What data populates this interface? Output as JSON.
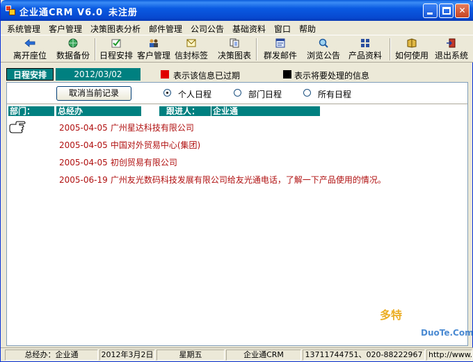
{
  "window": {
    "title": "企业通CRM V6.0",
    "registration": "未注册"
  },
  "menu": [
    "系统管理",
    "客户管理",
    "决策图表分析",
    "邮件管理",
    "公司公告",
    "基础资料",
    "窗口",
    "帮助"
  ],
  "toolbar": [
    {
      "label": "离开座位",
      "icon": "back-arrow-icon"
    },
    {
      "label": "数据备份",
      "icon": "globe-backup-icon"
    },
    {
      "label": "日程安排",
      "icon": "checkmark-schedule-icon"
    },
    {
      "label": "客户管理",
      "icon": "people-icon"
    },
    {
      "label": "信封标签",
      "icon": "envelope-label-icon"
    },
    {
      "label": "决策图表",
      "icon": "documents-icon"
    },
    {
      "label": "群发邮件",
      "icon": "mail-window-icon"
    },
    {
      "label": "浏览公告",
      "icon": "magnifier-icon"
    },
    {
      "label": "产品资料",
      "icon": "grid-icon"
    },
    {
      "label": "如何使用",
      "icon": "book-icon"
    },
    {
      "label": "退出系统",
      "icon": "exit-door-icon"
    }
  ],
  "schedule": {
    "label": "日程安排",
    "date": "2012/03/02",
    "legend_expired": "表示该信息已过期",
    "legend_pending": "表示将要处理的信息",
    "cancel_button": "取消当前记录",
    "scope_options": [
      "个人日程",
      "部门日程",
      "所有日程"
    ],
    "scope_selected": "个人日程",
    "dept_label": "部门：",
    "dept_value": "总经办",
    "follower_label": "跟进人：",
    "follower_value": "企业通",
    "records": [
      {
        "date": "2005-04-05",
        "text": "广州星达科技有限公司"
      },
      {
        "date": "2005-04-05",
        "text": "中国对外贸易中心(集团)"
      },
      {
        "date": "2005-04-05",
        "text": "初创贸易有限公司"
      },
      {
        "date": "2005-06-19",
        "text": "广州友光数码科技发展有限公司给友光通电话，了解一下产品使用的情况。"
      }
    ]
  },
  "colors": {
    "teal": "#008080",
    "record_red": "#b01010",
    "expired": "#e00000",
    "pending": "#000000"
  },
  "statusbar": {
    "user": "总经办：企业通",
    "date": "2012年3月2日",
    "weekday": "星期五",
    "product": "企业通CRM",
    "phone": "13711744751、020-88222967",
    "url": "http://www."
  },
  "watermark": {
    "brand": "多特",
    "site": "DuoTe.Com"
  }
}
